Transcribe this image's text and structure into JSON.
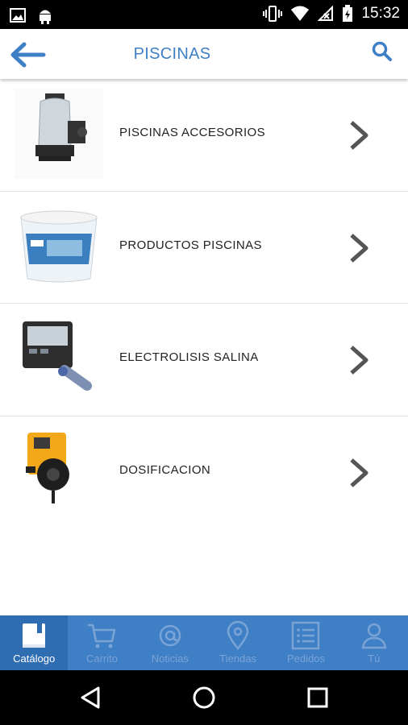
{
  "status_bar": {
    "time": "15:32"
  },
  "header": {
    "title": "PISCINAS"
  },
  "categories": [
    {
      "label": "PISCINAS ACCESORIOS"
    },
    {
      "label": "PRODUCTOS PISCINAS"
    },
    {
      "label": "ELECTROLISIS SALINA"
    },
    {
      "label": "DOSIFICACION"
    }
  ],
  "bottom_nav": [
    {
      "label": "Catálogo",
      "icon": "book-icon",
      "active": true
    },
    {
      "label": "Carrito",
      "icon": "cart-icon",
      "active": false
    },
    {
      "label": "Noticias",
      "icon": "at-icon",
      "active": false
    },
    {
      "label": "Tiendas",
      "icon": "location-pin-icon",
      "active": false
    },
    {
      "label": "Pedidos",
      "icon": "list-icon",
      "active": false
    },
    {
      "label": "Tú",
      "icon": "person-icon",
      "active": false
    }
  ],
  "colors": {
    "accent": "#3f7fc6",
    "nav_active": "#2f6db3",
    "nav_inactive_text": "#7aa3d6"
  }
}
